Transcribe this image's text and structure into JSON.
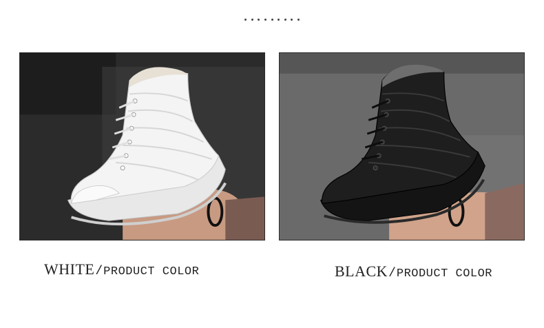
{
  "header": {
    "dots_count": 9
  },
  "products": [
    {
      "color_name": "WHITE",
      "slash": "/",
      "suffix": "PRODUCT COLOR",
      "boot_color": "#f2f2f2",
      "icon": "white-snow-boot-photo"
    },
    {
      "color_name": "BLACK",
      "slash": "/",
      "suffix": "PRODUCT COLOR",
      "boot_color": "#1a1a1a",
      "icon": "black-snow-boot-photo"
    }
  ]
}
